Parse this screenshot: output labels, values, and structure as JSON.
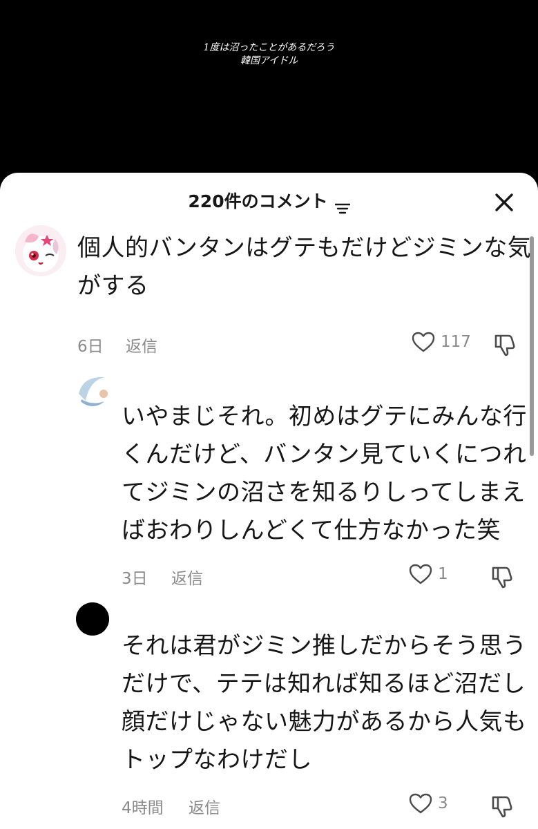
{
  "video": {
    "caption_lines": [
      "1度は沼ったことがあるだろう",
      "韓国アイドル"
    ]
  },
  "comments_panel": {
    "title": "220件のコメント",
    "sort_icon": "sort-lines-icon",
    "close_icon": "close-icon"
  },
  "comments": [
    {
      "text_lines": [
        "個人的バンタンはグテもだけどジミンな気",
        "がする"
      ],
      "time": "6日",
      "reply_label": "返信",
      "likes": "117",
      "avatar": "anime-jewelpet-avatar"
    },
    {
      "text_lines": [
        "いやまじそれ。初めはグテにみんな行",
        "くんだけど、バンタン見ていくにつれ",
        "てジミンの沼さを知るりしってしまえ",
        "ばおわりしんどくて仕方なかった笑"
      ],
      "time": "3日",
      "reply_label": "返信",
      "likes": "1",
      "avatar": "partial-avatar"
    },
    {
      "text_lines": [
        "それは君がジミン推しだからそう思う",
        "だけで、テテは知れば知るほど沼だし",
        "顔だけじゃない魅力があるから人気も",
        "トップなわけだし"
      ],
      "time": "4時間",
      "reply_label": "返信",
      "likes": "3",
      "avatar": "black-circle-avatar"
    }
  ],
  "colors": {
    "background": "#000000",
    "sheet": "#ffffff",
    "text": "#161616",
    "meta": "#8a8a8a"
  }
}
